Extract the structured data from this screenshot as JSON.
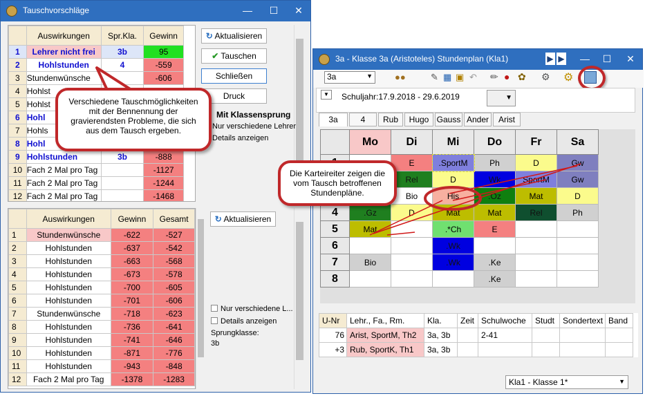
{
  "left_window": {
    "title": "Tauschvorschläge",
    "top_table": {
      "headers": [
        "Auswirkungen",
        "Spr.Kla.",
        "Gewinn"
      ],
      "rows": [
        [
          "1",
          "Lehrer nicht frei",
          "3b",
          "95"
        ],
        [
          "2",
          "Hohlstunden",
          "4",
          "-559"
        ],
        [
          "3",
          "Stundenwünsche",
          "",
          "-606"
        ],
        [
          "4",
          "Hohlst",
          "",
          ""
        ],
        [
          "5",
          "Hohlst",
          "",
          ""
        ],
        [
          "6",
          "Hohl",
          "",
          ""
        ],
        [
          "7",
          "Hohls",
          "",
          ""
        ],
        [
          "8",
          "Hohl",
          "",
          ""
        ],
        [
          "9",
          "Hohlstunden",
          "3b",
          "-888"
        ],
        [
          "10",
          "Fach 2 Mal pro Tag",
          "",
          "-1127"
        ],
        [
          "11",
          "Fach 2 Mal pro Tag",
          "",
          "-1244"
        ],
        [
          "12",
          "Fach 2 Mal pro Tag",
          "",
          "-1468"
        ]
      ]
    },
    "buttons": {
      "aktualisieren": "Aktualisieren",
      "tauschen": "Tauschen",
      "schliessen": "Schließen",
      "druck": "Druck"
    },
    "options_top": {
      "klassensprung": "Mit Klassensprung",
      "verschiedene": "Nur verschiedene Lehrer",
      "details": "Details anzeigen"
    },
    "bottom_table": {
      "headers": [
        "Auswirkungen",
        "Gewinn",
        "Gesamt"
      ],
      "rows": [
        [
          "1",
          "Stundenwünsche",
          "-622",
          "-527"
        ],
        [
          "2",
          "Hohlstunden",
          "-637",
          "-542"
        ],
        [
          "3",
          "Hohlstunden",
          "-663",
          "-568"
        ],
        [
          "4",
          "Hohlstunden",
          "-673",
          "-578"
        ],
        [
          "5",
          "Hohlstunden",
          "-700",
          "-605"
        ],
        [
          "6",
          "Hohlstunden",
          "-701",
          "-606"
        ],
        [
          "7",
          "Stundenwünsche",
          "-718",
          "-623"
        ],
        [
          "8",
          "Hohlstunden",
          "-736",
          "-641"
        ],
        [
          "9",
          "Hohlstunden",
          "-741",
          "-646"
        ],
        [
          "10",
          "Hohlstunden",
          "-871",
          "-776"
        ],
        [
          "11",
          "Hohlstunden",
          "-943",
          "-848"
        ],
        [
          "12",
          "Fach 2 Mal pro Tag",
          "-1378",
          "-1283"
        ]
      ]
    },
    "bottom_aktualisieren": "Aktualisieren",
    "options_bottom": {
      "verschiedene": "Nur verschiedene L...",
      "details": "Details anzeigen",
      "sprungklasse_label": "Sprungklasse:",
      "sprungklasse_value": "3b"
    }
  },
  "callout1": "Verschiedene Tauschmöglichkeiten mit der Bennennung der gravierendsten Probleme, die sich aus dem Tausch ergeben.",
  "callout2": "Die Karteireiter zeigen die vom Tausch betroffenen Stundenpläne.",
  "right_window": {
    "title": "3a - Klasse 3a (Aristoteles)  Stundenplan  (Kla1)",
    "class_select": "3a",
    "schuljahr": "Schuljahr:17.9.2018 - 29.6.2019",
    "tabs": [
      "3a",
      "4",
      "Rub",
      "Hugo",
      "Gauss",
      "Ander",
      "Arist"
    ],
    "days": [
      "Mo",
      "Di",
      "Mi",
      "Do",
      "Fr",
      "Sa"
    ],
    "periods": [
      "1",
      "2",
      "3",
      "4",
      "5",
      "6",
      "7",
      "8"
    ],
    "lessons": [
      [
        "",
        "E",
        ".SportM",
        "Ph",
        "D",
        "Gw"
      ],
      [
        "",
        "Rel",
        "D",
        "Wk",
        "SportM",
        "Gw"
      ],
      [
        "",
        "Bio",
        "His",
        ".Oz",
        "Mat",
        "D"
      ],
      [
        ".Gz",
        "D",
        "Mat",
        "Mat",
        "Rel",
        "Ph"
      ],
      [
        "Mat",
        "",
        ".*Ch",
        "E",
        "",
        ""
      ],
      [
        "",
        "",
        ".Wk",
        "",
        "",
        ""
      ],
      [
        "Bio",
        "",
        ".Wk",
        ".Ke",
        "",
        ""
      ],
      [
        "",
        "",
        "",
        ".Ke",
        "",
        ""
      ]
    ],
    "lesson_colors": [
      [
        "#fff",
        "#f48080",
        "#7f7fdd",
        "#d0d0d0",
        "#fbfb8c",
        "#7f7fbf"
      ],
      [
        "#fff",
        "#1f7f1f",
        "#fbfb8c",
        "#0000e0",
        "#7f7fdd",
        "#7f7fbf"
      ],
      [
        "#fff",
        "#fff",
        "#f7b0a0",
        "#0f7f0f",
        "#bdbd00",
        "#fbfb8c"
      ],
      [
        "#1f7f1f",
        "#fbfb8c",
        "#bdbd00",
        "#bdbd00",
        "#0f4f2f",
        "#d0d0d0"
      ],
      [
        "#bdbd00",
        "#fff",
        "#70e070",
        "#f48080",
        "#fff",
        "#fff"
      ],
      [
        "#fff",
        "#fff",
        "#0000e0",
        "#fff",
        "#fff",
        "#fff"
      ],
      [
        "#d0d0d0",
        "#fff",
        "#0000e0",
        "#d0d0d0",
        "#fff",
        "#fff"
      ],
      [
        "#fff",
        "#fff",
        "#fff",
        "#d0d0d0",
        "#fff",
        "#fff"
      ]
    ],
    "lesson_headers": [
      "U-Nr",
      "Lehr., Fa., Rm.",
      "Kla.",
      "Zeit",
      "Schulwoche",
      "Studt",
      "Sondertext",
      "Band"
    ],
    "lesson_rows": [
      [
        "76",
        "Arist, SportM, Th2",
        "3a, 3b",
        "",
        "2-41",
        "",
        "",
        ""
      ],
      [
        "+3",
        "Rub, SportK, Th1",
        "3a, 3b",
        "",
        "",
        "",
        "",
        ""
      ]
    ],
    "footer_select": "Kla1 - Klasse 1*"
  }
}
